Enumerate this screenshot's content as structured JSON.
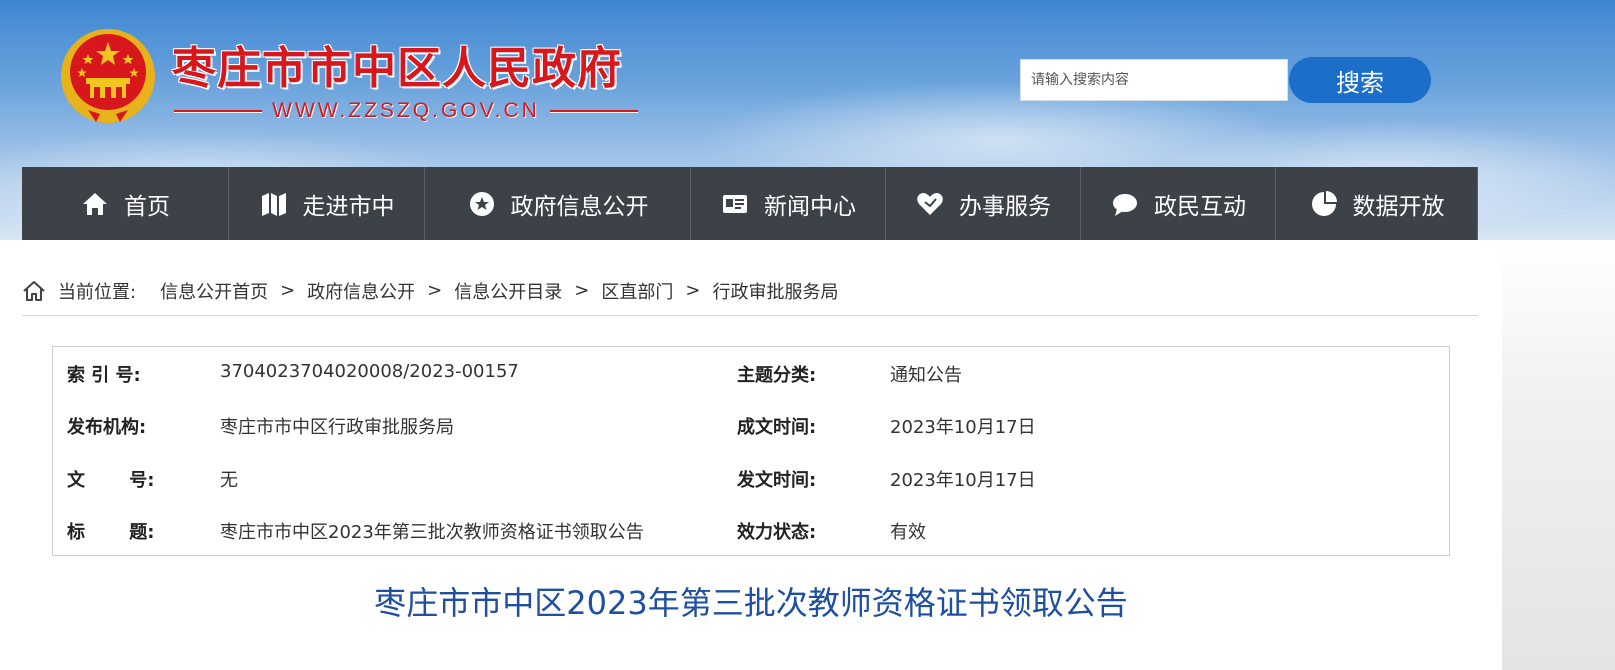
{
  "header": {
    "site_title": "枣庄市市中区人民政府",
    "site_url": "WWW.ZZSZQ.GOV.CN",
    "search_placeholder": "请输入搜索内容",
    "search_button": "搜索"
  },
  "nav": {
    "items": [
      {
        "label": "首页",
        "icon": "home-icon"
      },
      {
        "label": "走进市中",
        "icon": "map-icon"
      },
      {
        "label": "政府信息公开",
        "icon": "star-badge-icon"
      },
      {
        "label": "新闻中心",
        "icon": "id-card-icon"
      },
      {
        "label": "办事服务",
        "icon": "heart-icon"
      },
      {
        "label": "政民互动",
        "icon": "chat-bubble-icon"
      },
      {
        "label": "数据开放",
        "icon": "pie-chart-icon"
      }
    ]
  },
  "breadcrumb": {
    "label": "当前位置:",
    "items": [
      "信息公开首页",
      "政府信息公开",
      "信息公开目录",
      "区直部门",
      "行政审批服务局"
    ],
    "separator": ">"
  },
  "info": {
    "rows": [
      {
        "k1": "索 引 号:",
        "v1": "3704023704020008/2023-00157",
        "k2": "主题分类:",
        "v2": "通知公告"
      },
      {
        "k1": "发布机构:",
        "v1": "枣庄市市中区行政审批服务局",
        "k2": "成文时间:",
        "v2": "2023年10月17日"
      },
      {
        "k1": "文 号:",
        "v1": "无",
        "k2": "发文时间:",
        "v2": "2023年10月17日"
      },
      {
        "k1": "标 题:",
        "v1": "枣庄市市中区2023年第三批次教师资格证书领取公告",
        "k2": "效力状态:",
        "v2": "有效"
      }
    ]
  },
  "article": {
    "title": "枣庄市市中区2023年第三批次教师资格证书领取公告"
  },
  "colors": {
    "brand_red": "#d8171c",
    "nav_bg": "#3c4248",
    "search_blue": "#1b6fc8",
    "title_blue": "#1f4fa0"
  }
}
